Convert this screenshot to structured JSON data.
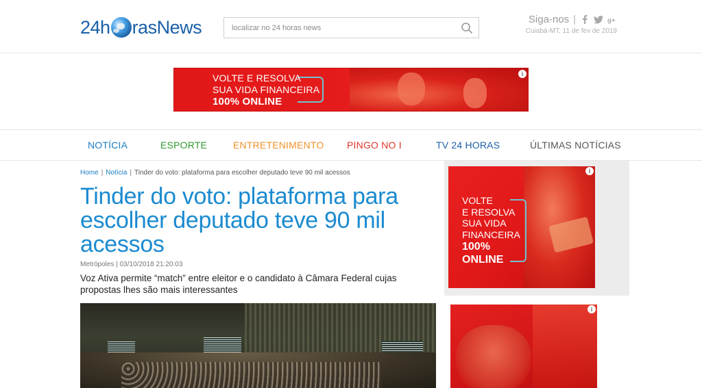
{
  "header": {
    "logo_pre": "24h",
    "logo_post": "rasNews",
    "search_placeholder": "localizar no 24 horas news",
    "follow_label": "Siga-nos",
    "follow_sep": "|",
    "location_date": "Cuiabá-MT, 11 de fev de 2019"
  },
  "ads": {
    "top": {
      "line1": "VOLTE E RESOLVA",
      "line2": "SUA VIDA FINANCEIRA",
      "line3": "100% ONLINE"
    },
    "side": {
      "line1": "VOLTE",
      "line2": "E RESOLVA",
      "line3": "SUA VIDA",
      "line4": "FINANCEIRA",
      "line5": "100%",
      "line6": "ONLINE"
    }
  },
  "nav": {
    "items": [
      {
        "label": "NOTÍCIA",
        "color": "#1a7cc4"
      },
      {
        "label": "ESPORTE",
        "color": "#2e9a2e"
      },
      {
        "label": "ENTRETENIMENTO",
        "color": "#f0902a"
      },
      {
        "label": "PINGO NO I",
        "color": "#e0342a"
      },
      {
        "label": "TV 24 HORAS",
        "color": "#1a5fa8"
      },
      {
        "label": "ÚLTIMAS NOTÍCIAS",
        "color": "#555555"
      }
    ]
  },
  "breadcrumb": {
    "home": "Home",
    "section": "Notícia",
    "current": "Tinder do voto: plataforma para escolher deputado teve 90 mil acessos",
    "sep": "|"
  },
  "article": {
    "title": "Tinder do voto: plataforma para escolher deputado teve 90 mil acessos",
    "meta": "Metrópoles | 03/10/2018 21:20:03",
    "lead": "Voz Ativa permite “match” entre eleitor e o candidato à Câmara Federal cujas propostas lhes são mais interessantes"
  },
  "colors": {
    "brand_blue": "#1a8ad0",
    "ad_red": "#e21818"
  }
}
